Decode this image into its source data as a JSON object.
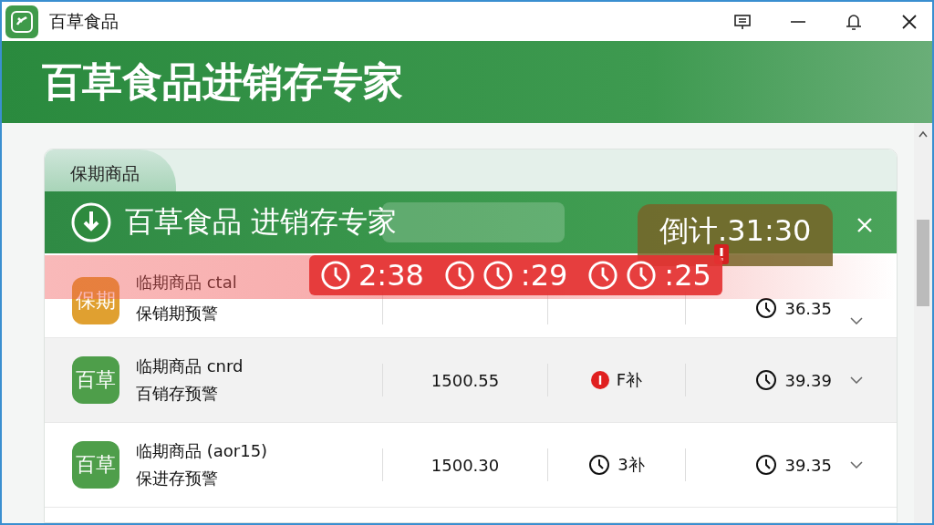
{
  "window": {
    "title": "百草食品"
  },
  "header": {
    "title": "百草食品进销存专家"
  },
  "panel": {
    "tab": "保期商品",
    "banner_title": "百草食品 进销存专家"
  },
  "alert": {
    "countdown": "倒计.31:30",
    "timers": [
      {
        "kind": "single",
        "text": "2:38"
      },
      {
        "kind": "double",
        "text": ":29"
      },
      {
        "kind": "double",
        "text": ":25"
      }
    ]
  },
  "rows": [
    {
      "badge": "保期",
      "color": "#e0a030",
      "name": "临期商品 ctal",
      "subtitle": "保销期预警",
      "time": "36.35"
    },
    {
      "badge": "百草",
      "color": "#4e9e4a",
      "name": "临期商品 cnrd",
      "subtitle": "百销存预警",
      "price": "1500.55",
      "status": {
        "kind": "alert",
        "text": "F补"
      },
      "time": "39.39"
    },
    {
      "badge": "百草",
      "color": "#4e9e4a",
      "name": "临期商品 (aor15)",
      "subtitle": "保进存预警",
      "price": "1500.30",
      "status": {
        "kind": "clock",
        "text": "3补"
      },
      "time": "39.35"
    }
  ]
}
